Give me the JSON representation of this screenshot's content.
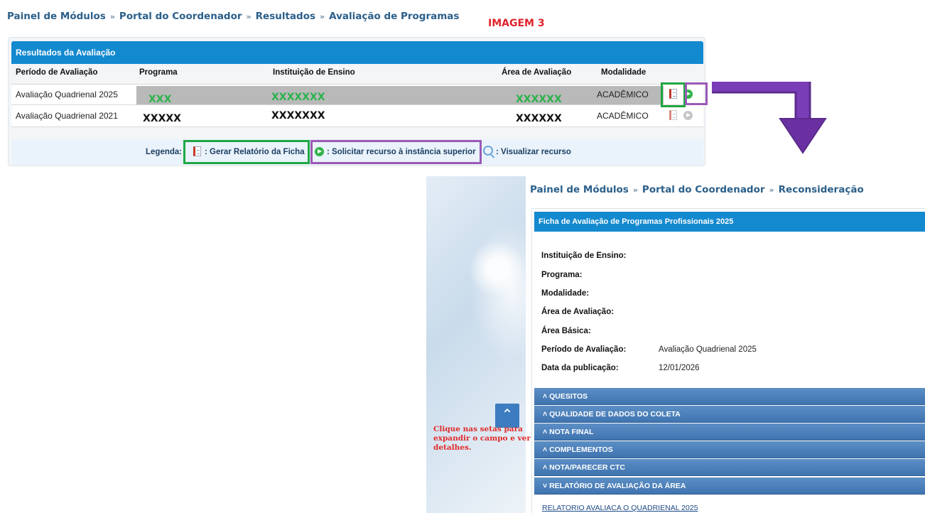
{
  "imagem3": {
    "breadcrumb": [
      "Painel de Módulos",
      "Portal do Coordenador",
      "Resultados",
      "Avaliação de Programas"
    ],
    "label": "IMAGEM 3",
    "panel_title": "Resultados da Avaliação",
    "columns": [
      "Período de Avaliação",
      "Programa",
      "Instituição de Ensino",
      "Área de Avaliação",
      "Modalidade"
    ],
    "rows": [
      {
        "periodo": "Avaliação Quadrienal 2025",
        "programa": "XXX",
        "instituicao": "XXXXXXX",
        "area": "XXXXXX",
        "modalidade": "ACADÊMICO"
      },
      {
        "periodo": "Avaliação Quadrienal 2021",
        "programa": "XXXXX",
        "instituicao": "XXXXXXX",
        "area": "XXXXXX",
        "modalidade": "ACADÊMICO"
      }
    ],
    "legend": {
      "title": "Legenda:",
      "report": ": Gerar Relatório da Ficha",
      "appeal": ": Solicitar recurso à instância superior",
      "view": ": Visualizar recurso"
    }
  },
  "reconsideracao": {
    "breadcrumb": [
      "Painel de Módulos",
      "Portal do Coordenador",
      "Reconsideração"
    ],
    "panel_title": "Ficha de Avaliação de Programas Profissionais 2025",
    "fields": [
      {
        "label": "Instituição de Ensino:",
        "value": ""
      },
      {
        "label": "Programa:",
        "value": ""
      },
      {
        "label": "Modalidade:",
        "value": ""
      },
      {
        "label": "Área de Avaliação:",
        "value": ""
      },
      {
        "label": "Área Básica:",
        "value": ""
      },
      {
        "label": "Período de Avaliação:",
        "value": "Avaliação Quadrienal 2025"
      },
      {
        "label": "Data da publicação:",
        "value": "12/01/2026"
      }
    ],
    "sections": [
      "QUESITOS",
      "QUALIDADE DE DADOS DO COLETA",
      "NOTA FINAL",
      "COMPLEMENTOS",
      "NOTA/PARECER CTC",
      "RELATÓRIO DE AVALIAÇÃO DA ÁREA"
    ],
    "report_link": "RELATORIO AVALIACA O QUADRIENAL 2025",
    "hint": "Clique nas setas para expandir o campo e ver detalhes."
  },
  "colors": {
    "header_blue": "#1389cf",
    "green_box": "#1fa743",
    "purple_box": "#9b59b6",
    "arrow": "#6a2fa0"
  },
  "icons": [
    "document-icon",
    "play-circle-icon",
    "magnifier-icon",
    "double-chevron-up-icon",
    "chevron-up-icon",
    "chevron-down-icon"
  ]
}
